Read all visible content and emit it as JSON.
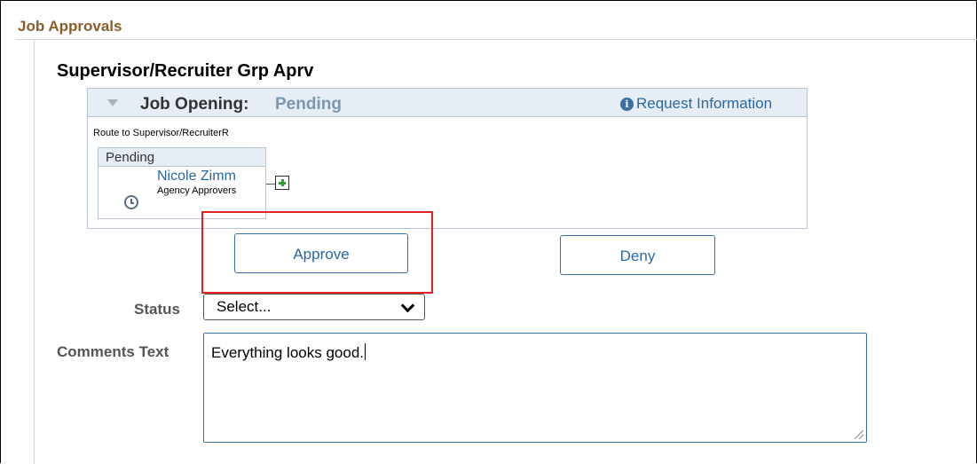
{
  "header": {
    "title": "Job Approvals"
  },
  "section": {
    "title": "Supervisor/Recruiter Grp Aprv"
  },
  "route": {
    "job_label": "Job Opening:",
    "job_status": "Pending",
    "request_info_label": "Request Information",
    "route_to": "Route to Supervisor/RecruiterR",
    "step": {
      "status": "Pending",
      "approver_name": "Nicole Zimm",
      "approver_group": "Agency Approvers"
    }
  },
  "actions": {
    "approve_label": "Approve",
    "deny_label": "Deny"
  },
  "form": {
    "status_label": "Status",
    "status_value": "Select...",
    "comments_label": "Comments Text",
    "comments_value": "Everything looks good."
  },
  "colors": {
    "header_title": "#8a5d2b",
    "link": "#2a68a4",
    "highlight": "#e32222",
    "panel_header": "#e6edf4"
  },
  "icons": [
    "collapse-triangle-icon",
    "info-icon",
    "clock-icon",
    "add-plus-icon",
    "chevron-down-icon",
    "resize-grip-icon"
  ]
}
